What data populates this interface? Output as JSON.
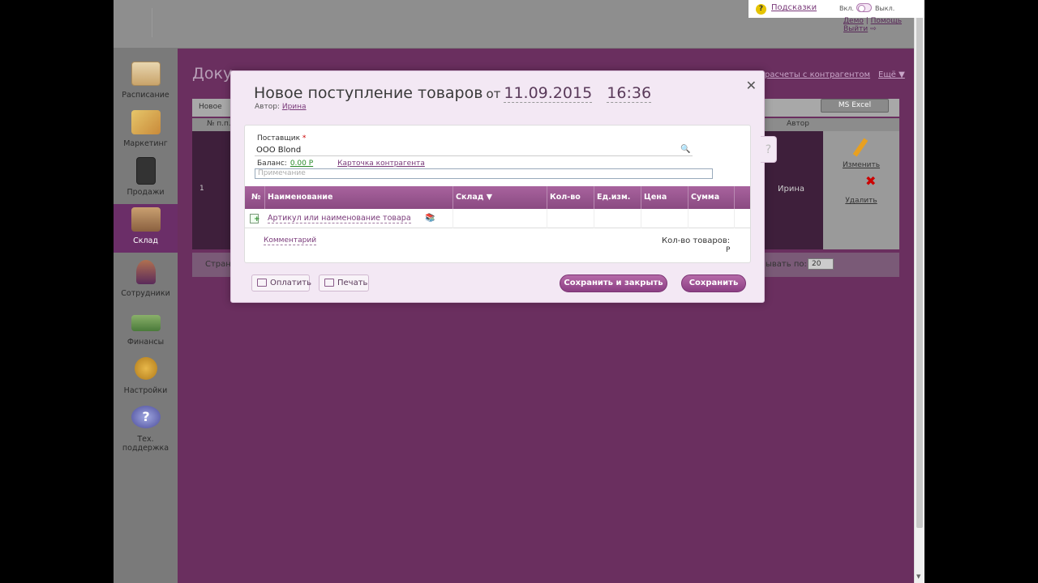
{
  "topbar": {
    "hints_label": "Подсказки",
    "toggle_on": "Вкл.",
    "toggle_off": "Выкл.",
    "user_name": "Демо",
    "help_link": "Помощь",
    "logout": "Выйти"
  },
  "sidebar": {
    "items": [
      {
        "label": "Расписание",
        "icon": "calendar-icon"
      },
      {
        "label": "Маркетинг",
        "icon": "marketing-icon"
      },
      {
        "label": "Продажи",
        "icon": "sales-icon"
      },
      {
        "label": "Склад",
        "icon": "warehouse-icon"
      },
      {
        "label": "Сотрудники",
        "icon": "employees-icon"
      },
      {
        "label": "Финансы",
        "icon": "finance-icon"
      },
      {
        "label": "Настройки",
        "icon": "settings-icon"
      },
      {
        "label": "Тех. поддержка",
        "icon": "support-icon"
      }
    ]
  },
  "background_page": {
    "title": "Доку",
    "links": [
      "расчеты с контрагентом",
      "Ещё ▼"
    ],
    "new_button": "Новое",
    "excel_button": "MS Excel",
    "col_num": "№ п.п.",
    "col_author": "Автор",
    "row_num": "1",
    "row_author": "Ирина",
    "edit_action": "Изменить",
    "delete_action": "Удалить",
    "pager_left": "Стран",
    "pager_right": "ывать по:",
    "page_size": "20"
  },
  "modal": {
    "title": "Новое поступление товаров",
    "from_word": "от",
    "date": "11.09.2015",
    "time": "16:36",
    "author_label": "Автор:",
    "author_name": "Ирина",
    "help_tab": "?",
    "supplier_label": "Поставщик",
    "supplier_required_mark": "*",
    "supplier_value": "ООО Blond",
    "balance_label": "Баланс:",
    "balance_value": "0.00 Р",
    "counterparty_card": "Карточка контрагента",
    "note_placeholder": "Примечание",
    "columns": [
      "№",
      "Наименование",
      "Склад ▼",
      "Кол-во",
      "Ед.изм.",
      "Цена",
      "Сумма"
    ],
    "article_placeholder": "Артикул или наименование товара",
    "comment_link": "Комментарий",
    "qty_total_label": "Кол-во товаров:",
    "currency_sign": "Р",
    "pay_button": "Оплатить",
    "print_button": "Печать",
    "save_close_button": "Сохранить и закрыть",
    "save_button": "Сохранить"
  },
  "colors": {
    "app_bg": "#6a2f5f",
    "accent": "#8c3f84",
    "modal_bg": "#f3e8f4"
  }
}
